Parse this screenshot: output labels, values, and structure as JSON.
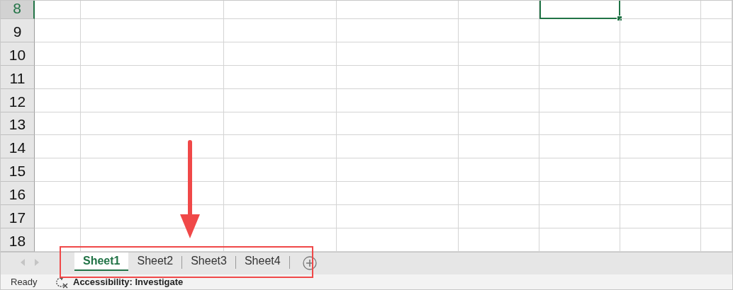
{
  "rows": [
    {
      "label": "8",
      "selected": true
    },
    {
      "label": "9",
      "selected": false
    },
    {
      "label": "10",
      "selected": false
    },
    {
      "label": "11",
      "selected": false
    },
    {
      "label": "12",
      "selected": false
    },
    {
      "label": "13",
      "selected": false
    },
    {
      "label": "14",
      "selected": false
    },
    {
      "label": "15",
      "selected": false
    },
    {
      "label": "16",
      "selected": false
    },
    {
      "label": "17",
      "selected": false
    },
    {
      "label": "18",
      "selected": false
    }
  ],
  "sheet_tabs": [
    {
      "label": "Sheet1",
      "selected": true
    },
    {
      "label": "Sheet2",
      "selected": false
    },
    {
      "label": "Sheet3",
      "selected": false
    },
    {
      "label": "Sheet4",
      "selected": false
    }
  ],
  "status_bar": {
    "status": "Ready",
    "accessibility": "Accessibility: Investigate"
  }
}
